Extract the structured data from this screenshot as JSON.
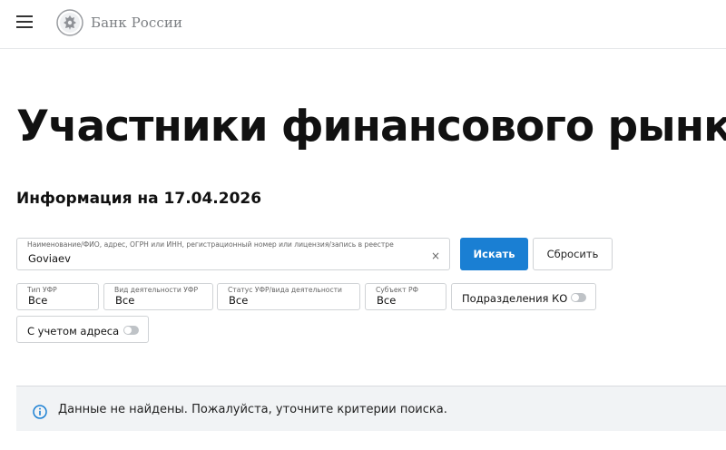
{
  "header": {
    "logo_text": "Банк России",
    "menu_icon": "hamburger-menu-icon",
    "emblem_icon": "bank-emblem-icon"
  },
  "page": {
    "title": "Участники финансового рынка",
    "info_date": "Информация на 17.04.2026"
  },
  "search": {
    "label": "Наименование/ФИО, адрес, ОГРН или ИНН, регистрационный номер или лицензия/запись в реестре",
    "value": "Goviaev",
    "clear_icon": "×",
    "search_button": "Искать",
    "reset_button": "Сбросить"
  },
  "filters": {
    "ufr_type": {
      "label": "Тип УФР",
      "value": "Все"
    },
    "activity_type": {
      "label": "Вид деятельности УФР",
      "value": "Все"
    },
    "status": {
      "label": "Статус УФР/вида деятельности",
      "value": "Все"
    },
    "region": {
      "label": "Субъект РФ",
      "value": "Все"
    },
    "ko_divisions": {
      "label": "Подразделения КО",
      "enabled": false
    },
    "with_address": {
      "label": "С учетом адреса",
      "enabled": false
    }
  },
  "notice": {
    "icon": "info-circle-icon",
    "text": "Данные не найдены. Пожалуйста, уточните критерии поиска."
  },
  "colors": {
    "accent": "#1a7fd3",
    "notice_bg": "#f1f3f5",
    "border": "#d0d3d6"
  }
}
